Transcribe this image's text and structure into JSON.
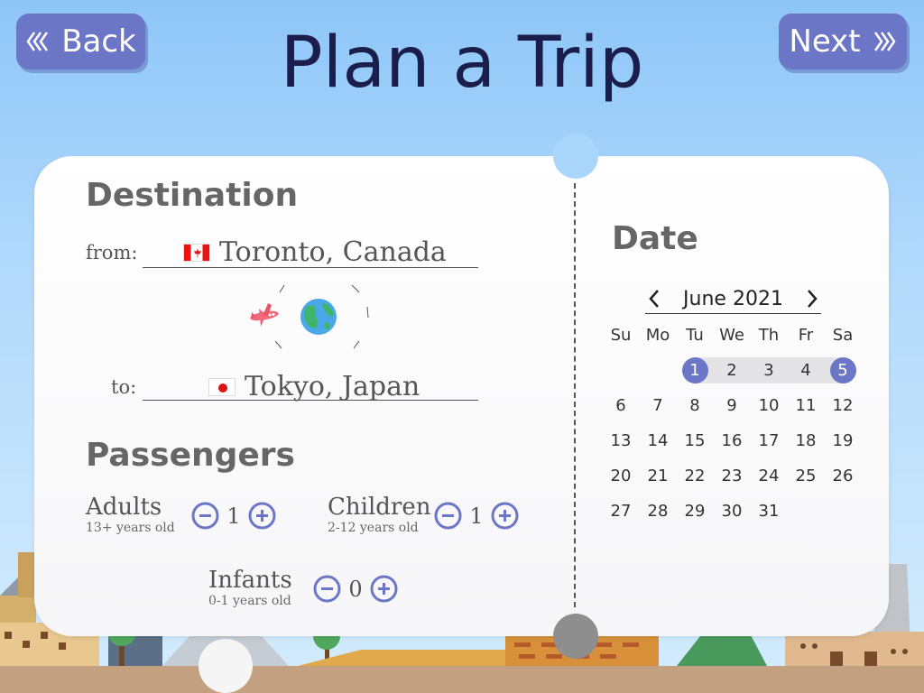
{
  "nav": {
    "back_label": "Back",
    "next_label": "Next"
  },
  "page_title": "Plan a Trip",
  "destination": {
    "heading": "Destination",
    "from_label": "from:",
    "from_value": "Toronto, Canada",
    "from_flag": "canada-flag-icon",
    "to_label": "to:",
    "to_value": "Tokyo, Japan",
    "to_flag": "japan-flag-icon"
  },
  "passengers": {
    "heading": "Passengers",
    "groups": [
      {
        "name": "Adults",
        "age": "13+ years old",
        "count": "1"
      },
      {
        "name": "Children",
        "age": "2-12 years old",
        "count": "1"
      },
      {
        "name": "Infants",
        "age": "0-1 years old",
        "count": "0"
      }
    ]
  },
  "date": {
    "heading": "Date",
    "month_label": "June 2021",
    "weekdays": [
      "Su",
      "Mo",
      "Tu",
      "We",
      "Th",
      "Fr",
      "Sa"
    ],
    "first_weekday_index": 2,
    "days_in_month": 31,
    "range_start": 1,
    "range_end": 5
  },
  "icons": [
    "chevron-double-left-icon",
    "chevron-double-right-icon",
    "airplane-icon",
    "globe-icon",
    "minus-circle-icon",
    "plus-circle-icon",
    "chevron-left-icon",
    "chevron-right-icon"
  ],
  "colors": {
    "accent": "#6b77c6",
    "title": "#1b1e4a",
    "heading": "#666666",
    "sky": "#a9d4fb",
    "range_fill": "#e4e4e6"
  }
}
